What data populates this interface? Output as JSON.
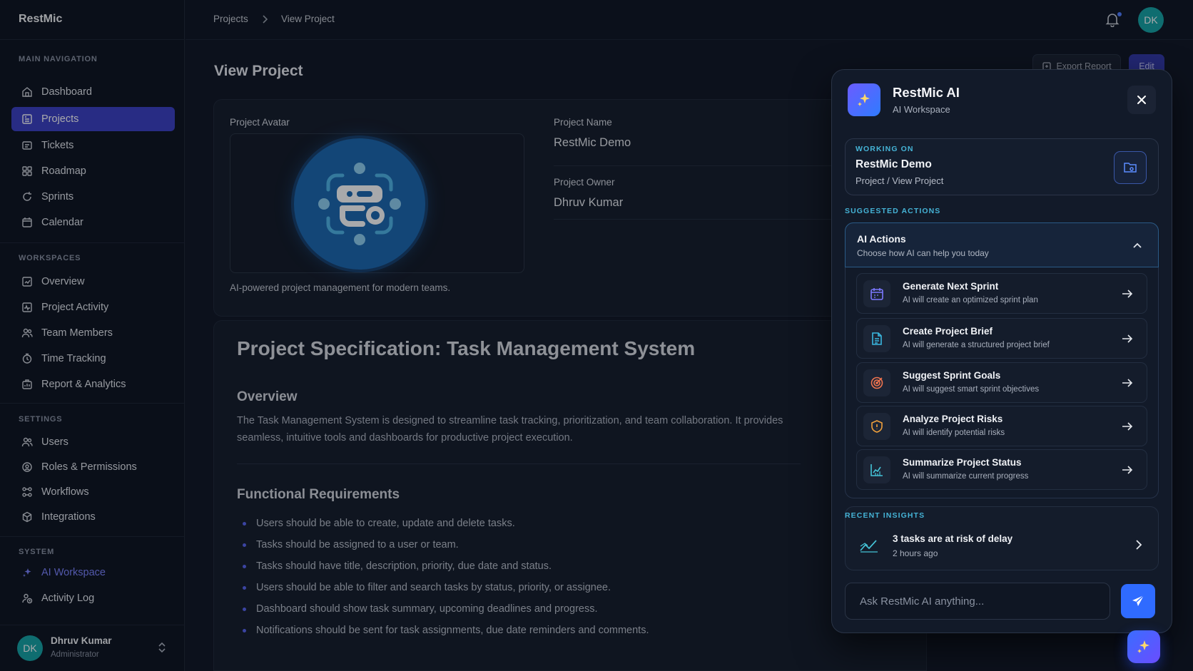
{
  "brand": "RestMic",
  "sidebar": {
    "sections": {
      "main": "MAIN NAVIGATION",
      "workspaces": "WORKSPACES",
      "settings": "SETTINGS",
      "system": "SYSTEM"
    },
    "main_items": [
      {
        "label": "Dashboard",
        "icon": "dashboard-icon"
      },
      {
        "label": "Projects",
        "icon": "projects-icon",
        "active": true
      },
      {
        "label": "Tickets",
        "icon": "tickets-icon"
      },
      {
        "label": "Roadmap",
        "icon": "roadmap-icon"
      },
      {
        "label": "Sprints",
        "icon": "sprints-icon"
      },
      {
        "label": "Calendar",
        "icon": "calendar-icon"
      }
    ],
    "workspace_items": [
      {
        "label": "Overview",
        "icon": "overview-icon"
      },
      {
        "label": "Project Activity",
        "icon": "activity-icon"
      },
      {
        "label": "Team Members",
        "icon": "team-icon"
      },
      {
        "label": "Time Tracking",
        "icon": "clock-icon"
      },
      {
        "label": "Report & Analytics",
        "icon": "report-icon"
      }
    ],
    "settings_items": [
      {
        "label": "Users",
        "icon": "users-icon"
      },
      {
        "label": "Roles & Permissions",
        "icon": "shield-icon"
      },
      {
        "label": "Workflows",
        "icon": "workflow-icon"
      },
      {
        "label": "Integrations",
        "icon": "puzzle-icon"
      }
    ],
    "system_items": [
      {
        "label": "AI Workspace",
        "icon": "sparkle-icon"
      },
      {
        "label": "Activity Log",
        "icon": "log-icon"
      }
    ],
    "user": {
      "initials": "DK",
      "name": "Dhruv Kumar",
      "role": "Administrator"
    }
  },
  "topbar": {
    "breadcrumb": [
      "Projects",
      "View Project"
    ],
    "avatar_initials": "DK"
  },
  "main": {
    "title": "View Project",
    "export_label": "Export Report",
    "edit_label": "Edit",
    "avatar_label": "Project Avatar",
    "description": "AI-powered project management for modern teams.",
    "project_name_label": "Project Name",
    "project_name": "RestMic Demo",
    "project_owner_label": "Project Owner",
    "project_owner": "Dhruv Kumar",
    "spec_title": "Project Specification: Task Management System",
    "overview_heading": "Overview",
    "overview_text": "The Task Management System is designed to streamline task tracking, prioritization, and team collaboration. It provides seamless, intuitive tools and dashboards for productive project execution.",
    "functional_heading": "Functional Requirements",
    "requirements": [
      "Users should be able to create, update and delete tasks.",
      "Tasks should be assigned to a user or team.",
      "Tasks should have title, description, priority, due date and status.",
      "Users should be able to filter and search tasks by status, priority, or assignee.",
      "Dashboard should show task summary, upcoming deadlines and progress.",
      "Notifications should be sent for task assignments, due date reminders and comments."
    ]
  },
  "ai_panel": {
    "title": "RestMic AI",
    "subtitle": "AI Workspace",
    "working_on_label": "WORKING ON",
    "working_on_name": "RestMic Demo",
    "working_on_path": "Project / View Project",
    "suggested_label": "SUGGESTED ACTIONS",
    "actions_title": "AI Actions",
    "actions_subtitle": "Choose how AI can help you today",
    "actions": [
      {
        "title": "Generate Next Sprint",
        "subtitle": "AI will create an optimized sprint plan",
        "icon": "calendar-icon",
        "color": "#6d6cf7"
      },
      {
        "title": "Create Project Brief",
        "subtitle": "AI will generate a structured project brief",
        "icon": "document-icon",
        "color": "#3ab8e0"
      },
      {
        "title": "Suggest Sprint Goals",
        "subtitle": "AI will suggest smart sprint objectives",
        "icon": "target-icon",
        "color": "#f0744f"
      },
      {
        "title": "Analyze Project Risks",
        "subtitle": "AI will identify potential risks",
        "icon": "shield-icon",
        "color": "#f0a03c"
      },
      {
        "title": "Summarize Project Status",
        "subtitle": "AI will summarize current progress",
        "icon": "chart-icon",
        "color": "#45c4d8"
      }
    ],
    "recent_label": "RECENT INSIGHTS",
    "insight_title": "3 tasks are at risk of delay",
    "insight_time": "2 hours ago",
    "input_placeholder": "Ask RestMic AI anything..."
  },
  "colors": {
    "accent": "#3b3fc4",
    "ai_accent": "#2f6bff",
    "teal": "#14a3a5"
  }
}
